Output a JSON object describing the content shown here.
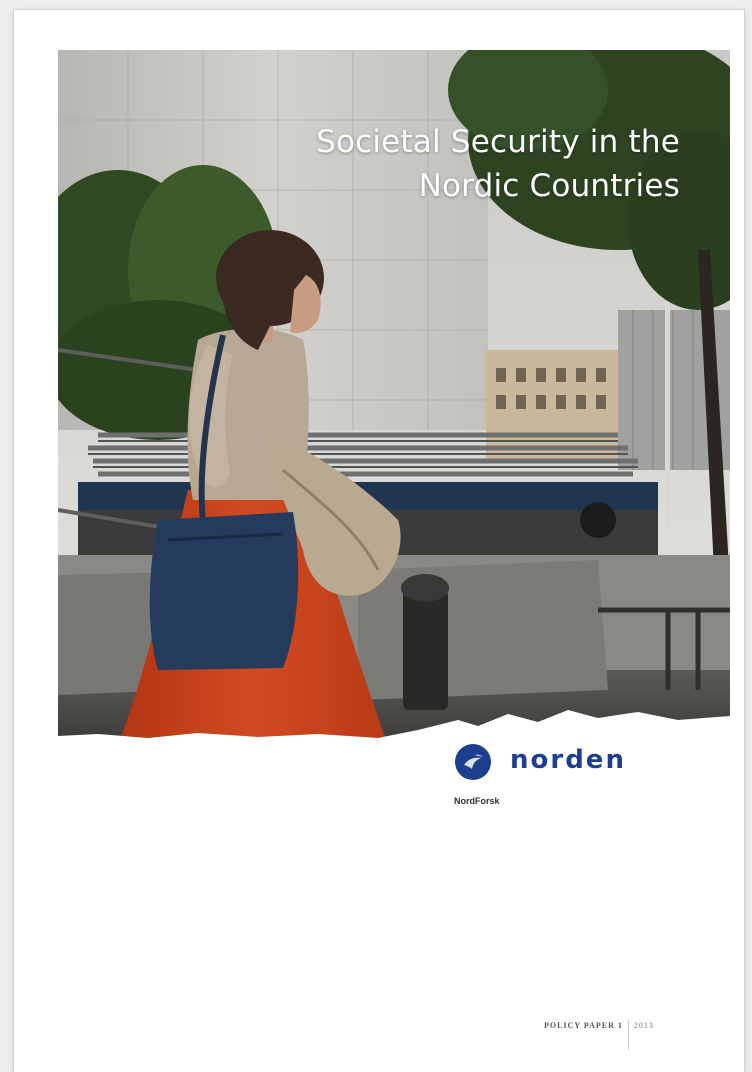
{
  "cover": {
    "title_line1": "Societal Security in the",
    "title_line2": "Nordic Countries",
    "publisher_logo_text": "norden",
    "publisher_unit": "NordForsk",
    "series_label": "POLICY PAPER 1",
    "year": "2013"
  },
  "colors": {
    "logo_blue": "#1e3f8f",
    "dress_orange": "#c8441f",
    "bag_navy": "#233a5e"
  },
  "icons": {
    "logo_mark": "norden-globe-icon"
  }
}
